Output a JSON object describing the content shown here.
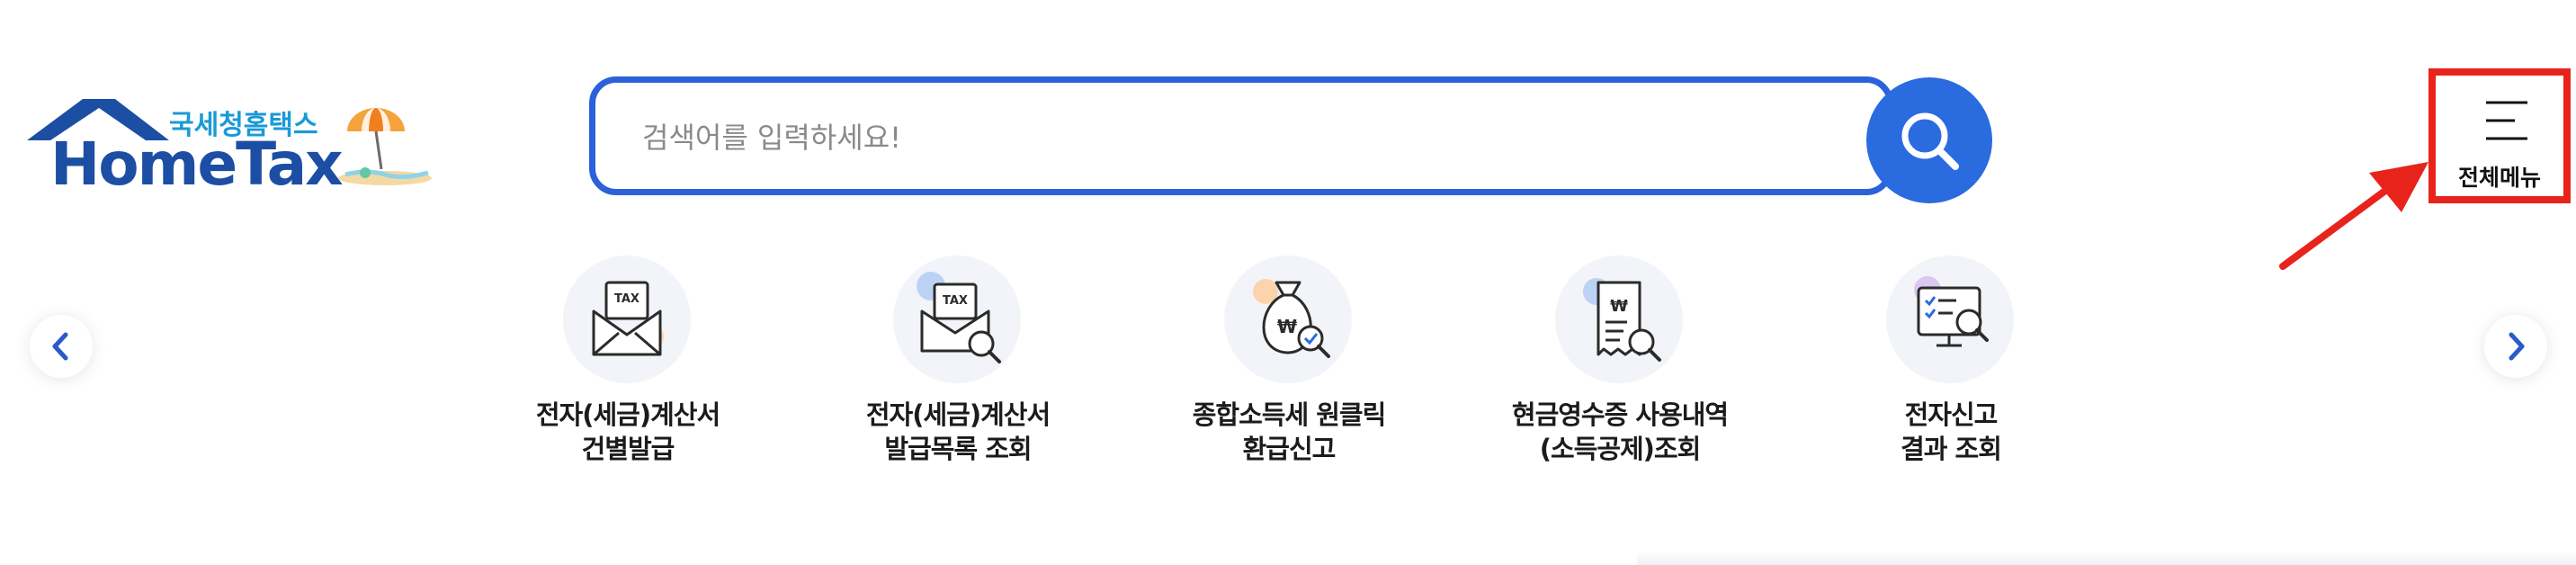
{
  "logo": {
    "sub": "국세청홈택스",
    "main": "HomeTax"
  },
  "search": {
    "placeholder": "검색어를 입력하세요!"
  },
  "menu": {
    "label": "전체메뉴"
  },
  "quick_links": [
    {
      "line1": "전자(세금)계산서",
      "line2": "건별발급",
      "icon": "tax-envelope-icon"
    },
    {
      "line1": "전자(세금)계산서",
      "line2": "발급목록 조회",
      "icon": "tax-envelope-search-icon"
    },
    {
      "line1": "종합소득세 원클릭",
      "line2": "환급신고",
      "icon": "money-bag-search-icon"
    },
    {
      "line1": "현금영수증 사용내역",
      "line2": "(소득공제)조회",
      "icon": "receipt-search-icon"
    },
    {
      "line1": "전자신고",
      "line2": "결과 조회",
      "icon": "monitor-checklist-search-icon"
    }
  ],
  "colors": {
    "brand_blue": "#2b62d9",
    "logo_blue": "#1c4fa3",
    "highlight_red": "#e8231c"
  }
}
